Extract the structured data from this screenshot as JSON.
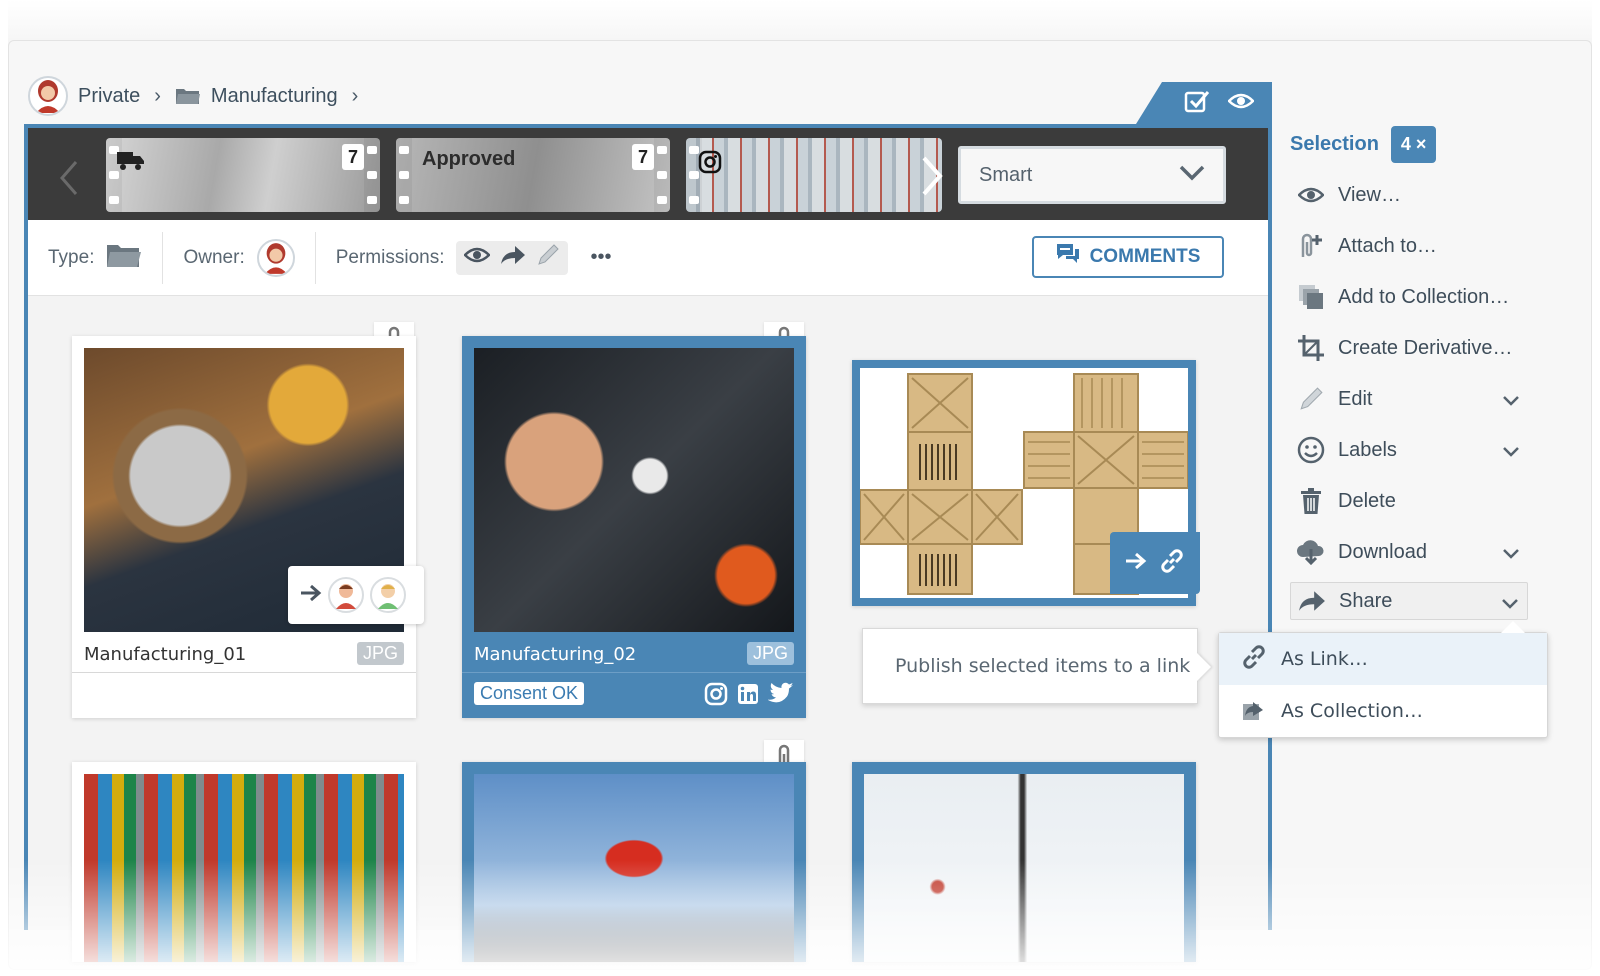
{
  "breadcrumb": {
    "items": [
      "Private",
      "Manufacturing"
    ]
  },
  "filmstrip": {
    "frames": [
      {
        "label": "",
        "count": "7",
        "icon": "truck-icon"
      },
      {
        "label": "Approved",
        "count": "7",
        "icon": ""
      },
      {
        "label": "",
        "count": "",
        "icon": "instagram-icon"
      }
    ],
    "smart_select": "Smart"
  },
  "infobar": {
    "type_label": "Type:",
    "owner_label": "Owner:",
    "permissions_label": "Permissions:",
    "more": "•••",
    "comments_label": "COMMENTS"
  },
  "cards": [
    {
      "title": "Manufacturing_01",
      "format": "JPG"
    },
    {
      "title": "Manufacturing_02",
      "format": "JPG",
      "status": "Consent OK"
    },
    {
      "title": "",
      "format": ""
    }
  ],
  "tooltip": "Publish selected items to a link",
  "selection": {
    "label": "Selection",
    "count": "4 ×",
    "actions": [
      {
        "label": "View…",
        "icon": "eye-icon"
      },
      {
        "label": "Attach to…",
        "icon": "attach-icon"
      },
      {
        "label": "Add to Collection…",
        "icon": "collection-icon"
      },
      {
        "label": "Create Derivative…",
        "icon": "crop-icon"
      },
      {
        "label": "Edit",
        "icon": "pencil-icon"
      },
      {
        "label": "Labels",
        "icon": "smiley-icon"
      },
      {
        "label": "Delete",
        "icon": "trash-icon"
      },
      {
        "label": "Download",
        "icon": "cloud-download-icon"
      },
      {
        "label": "Share",
        "icon": "share-icon"
      }
    ]
  },
  "share_menu": {
    "items": [
      "As Link…",
      "As Collection…"
    ]
  },
  "colors": {
    "accent": "#4a86b5",
    "text": "#3e4d5a"
  }
}
